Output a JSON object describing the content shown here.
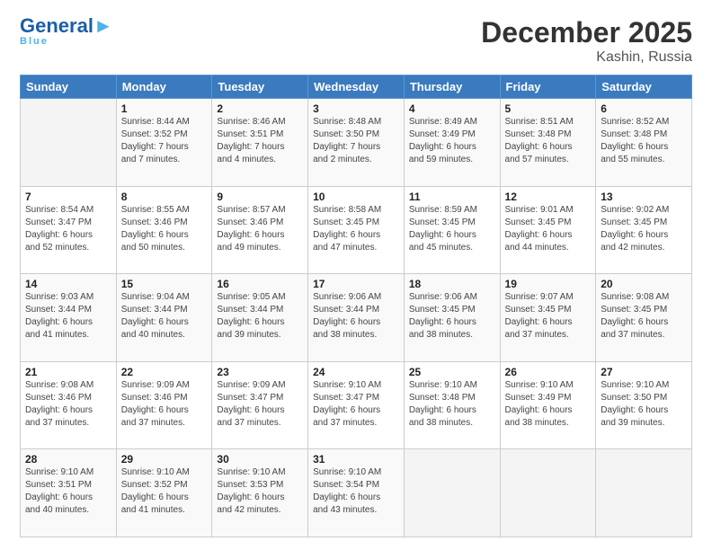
{
  "logo": {
    "main": "General",
    "sub": "Blue"
  },
  "title": "December 2025",
  "subtitle": "Kashin, Russia",
  "days_of_week": [
    "Sunday",
    "Monday",
    "Tuesday",
    "Wednesday",
    "Thursday",
    "Friday",
    "Saturday"
  ],
  "weeks": [
    [
      {
        "num": "",
        "info": ""
      },
      {
        "num": "1",
        "info": "Sunrise: 8:44 AM\nSunset: 3:52 PM\nDaylight: 7 hours\nand 7 minutes."
      },
      {
        "num": "2",
        "info": "Sunrise: 8:46 AM\nSunset: 3:51 PM\nDaylight: 7 hours\nand 4 minutes."
      },
      {
        "num": "3",
        "info": "Sunrise: 8:48 AM\nSunset: 3:50 PM\nDaylight: 7 hours\nand 2 minutes."
      },
      {
        "num": "4",
        "info": "Sunrise: 8:49 AM\nSunset: 3:49 PM\nDaylight: 6 hours\nand 59 minutes."
      },
      {
        "num": "5",
        "info": "Sunrise: 8:51 AM\nSunset: 3:48 PM\nDaylight: 6 hours\nand 57 minutes."
      },
      {
        "num": "6",
        "info": "Sunrise: 8:52 AM\nSunset: 3:48 PM\nDaylight: 6 hours\nand 55 minutes."
      }
    ],
    [
      {
        "num": "7",
        "info": "Sunrise: 8:54 AM\nSunset: 3:47 PM\nDaylight: 6 hours\nand 52 minutes."
      },
      {
        "num": "8",
        "info": "Sunrise: 8:55 AM\nSunset: 3:46 PM\nDaylight: 6 hours\nand 50 minutes."
      },
      {
        "num": "9",
        "info": "Sunrise: 8:57 AM\nSunset: 3:46 PM\nDaylight: 6 hours\nand 49 minutes."
      },
      {
        "num": "10",
        "info": "Sunrise: 8:58 AM\nSunset: 3:45 PM\nDaylight: 6 hours\nand 47 minutes."
      },
      {
        "num": "11",
        "info": "Sunrise: 8:59 AM\nSunset: 3:45 PM\nDaylight: 6 hours\nand 45 minutes."
      },
      {
        "num": "12",
        "info": "Sunrise: 9:01 AM\nSunset: 3:45 PM\nDaylight: 6 hours\nand 44 minutes."
      },
      {
        "num": "13",
        "info": "Sunrise: 9:02 AM\nSunset: 3:45 PM\nDaylight: 6 hours\nand 42 minutes."
      }
    ],
    [
      {
        "num": "14",
        "info": "Sunrise: 9:03 AM\nSunset: 3:44 PM\nDaylight: 6 hours\nand 41 minutes."
      },
      {
        "num": "15",
        "info": "Sunrise: 9:04 AM\nSunset: 3:44 PM\nDaylight: 6 hours\nand 40 minutes."
      },
      {
        "num": "16",
        "info": "Sunrise: 9:05 AM\nSunset: 3:44 PM\nDaylight: 6 hours\nand 39 minutes."
      },
      {
        "num": "17",
        "info": "Sunrise: 9:06 AM\nSunset: 3:44 PM\nDaylight: 6 hours\nand 38 minutes."
      },
      {
        "num": "18",
        "info": "Sunrise: 9:06 AM\nSunset: 3:45 PM\nDaylight: 6 hours\nand 38 minutes."
      },
      {
        "num": "19",
        "info": "Sunrise: 9:07 AM\nSunset: 3:45 PM\nDaylight: 6 hours\nand 37 minutes."
      },
      {
        "num": "20",
        "info": "Sunrise: 9:08 AM\nSunset: 3:45 PM\nDaylight: 6 hours\nand 37 minutes."
      }
    ],
    [
      {
        "num": "21",
        "info": "Sunrise: 9:08 AM\nSunset: 3:46 PM\nDaylight: 6 hours\nand 37 minutes."
      },
      {
        "num": "22",
        "info": "Sunrise: 9:09 AM\nSunset: 3:46 PM\nDaylight: 6 hours\nand 37 minutes."
      },
      {
        "num": "23",
        "info": "Sunrise: 9:09 AM\nSunset: 3:47 PM\nDaylight: 6 hours\nand 37 minutes."
      },
      {
        "num": "24",
        "info": "Sunrise: 9:10 AM\nSunset: 3:47 PM\nDaylight: 6 hours\nand 37 minutes."
      },
      {
        "num": "25",
        "info": "Sunrise: 9:10 AM\nSunset: 3:48 PM\nDaylight: 6 hours\nand 38 minutes."
      },
      {
        "num": "26",
        "info": "Sunrise: 9:10 AM\nSunset: 3:49 PM\nDaylight: 6 hours\nand 38 minutes."
      },
      {
        "num": "27",
        "info": "Sunrise: 9:10 AM\nSunset: 3:50 PM\nDaylight: 6 hours\nand 39 minutes."
      }
    ],
    [
      {
        "num": "28",
        "info": "Sunrise: 9:10 AM\nSunset: 3:51 PM\nDaylight: 6 hours\nand 40 minutes."
      },
      {
        "num": "29",
        "info": "Sunrise: 9:10 AM\nSunset: 3:52 PM\nDaylight: 6 hours\nand 41 minutes."
      },
      {
        "num": "30",
        "info": "Sunrise: 9:10 AM\nSunset: 3:53 PM\nDaylight: 6 hours\nand 42 minutes."
      },
      {
        "num": "31",
        "info": "Sunrise: 9:10 AM\nSunset: 3:54 PM\nDaylight: 6 hours\nand 43 minutes."
      },
      {
        "num": "",
        "info": ""
      },
      {
        "num": "",
        "info": ""
      },
      {
        "num": "",
        "info": ""
      }
    ]
  ]
}
